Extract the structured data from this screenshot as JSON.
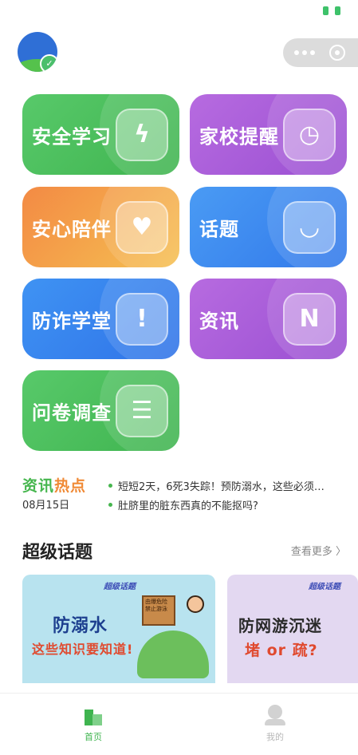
{
  "header": {
    "logo_badge": "✓"
  },
  "tiles": [
    {
      "label": "安全学习",
      "glyph": "ϟ",
      "icon": "lightning-shield-icon",
      "color": "#4cbf5c"
    },
    {
      "label": "家校提醒",
      "glyph": "◷",
      "icon": "clock-icon",
      "color": "#a85cdb"
    },
    {
      "label": "安心陪伴",
      "glyph": "♥",
      "icon": "heart-leaf-icon",
      "color": "#f3a04a"
    },
    {
      "label": "话题",
      "glyph": "◡",
      "icon": "chat-bubble-icon",
      "color": "#3f8ef2"
    },
    {
      "label": "防诈学堂",
      "glyph": "!",
      "icon": "alert-shield-icon",
      "color": "#3f8ef2"
    },
    {
      "label": "资讯",
      "glyph": "N",
      "icon": "news-icon",
      "color": "#a85cdb"
    },
    {
      "label": "问卷调查",
      "glyph": "☰",
      "icon": "survey-list-icon",
      "color": "#4cbf5c"
    }
  ],
  "news": {
    "title_a": "资讯",
    "title_b": "热点",
    "date": "08月15日",
    "items": [
      "短短2天，6死3失踪！预防溺水，这些必须…",
      "肚脐里的脏东西真的不能抠吗?"
    ]
  },
  "topics": {
    "title": "超级话题",
    "more": "查看更多 〉",
    "cards": [
      {
        "tag": "超级话题",
        "line1": "防溺水",
        "line2": "这些知识要知道!",
        "sign": "由爆危险 禁止游泳"
      },
      {
        "tag": "超级话题",
        "line1": "防网游沉迷",
        "line2": "堵 or 疏?"
      }
    ]
  },
  "tabbar": {
    "home": "首页",
    "me": "我的"
  }
}
